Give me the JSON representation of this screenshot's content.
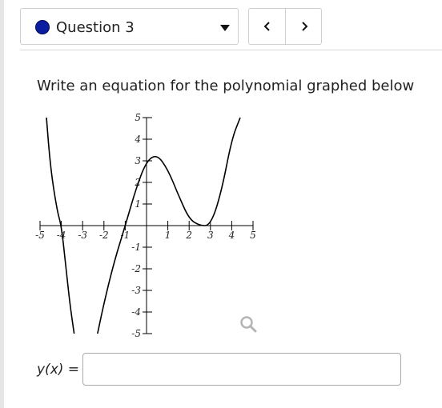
{
  "header": {
    "question_label": "Question 3",
    "status_color": "#0b1c9f",
    "prev_icon": "chevron-left-icon",
    "next_icon": "chevron-right-icon"
  },
  "prompt": "Write an equation for the polynomial graphed below",
  "chart_data": {
    "type": "line",
    "title": "",
    "xlabel": "",
    "ylabel": "",
    "xlim": [
      -5,
      5
    ],
    "ylim": [
      -5,
      5
    ],
    "x_ticks": [
      "-5",
      "-4",
      "-3",
      "-2",
      "-1",
      "1",
      "2",
      "3",
      "4",
      "5"
    ],
    "y_ticks": [
      "5",
      "4",
      "3",
      "2",
      "1",
      "-1",
      "-2",
      "-3",
      "-4",
      "-5"
    ],
    "series": [
      {
        "x": [
          -4.7,
          -4.5,
          -4.2,
          -4.0,
          -3.8,
          -3.6,
          -3.4
        ],
        "y": [
          5.0,
          2.6,
          0.7,
          0.0,
          -1.8,
          -3.6,
          -5.0
        ]
      },
      {
        "x": [
          -2.3,
          -2.0,
          -1.5,
          -1.0,
          -0.5,
          0.0,
          0.5,
          1.0,
          1.5,
          2.0,
          2.5,
          3.0,
          3.5,
          4.0,
          4.4
        ],
        "y": [
          -5.0,
          -3.6,
          -1.6,
          0.0,
          1.7,
          3.0,
          3.3,
          2.6,
          1.4,
          0.3,
          0.0,
          0.0,
          1.5,
          4.0,
          5.0
        ]
      }
    ],
    "grid": false
  },
  "answer": {
    "label_var": "y(x)",
    "label_eq": "=",
    "value": "",
    "placeholder": ""
  },
  "tools": {
    "zoom_icon": "magnifier-icon"
  }
}
